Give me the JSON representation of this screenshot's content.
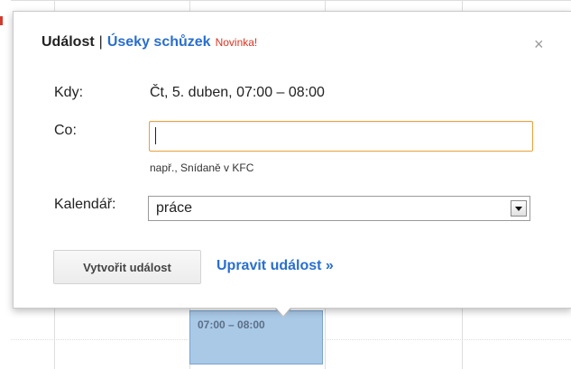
{
  "popup": {
    "tab_event": "Událost",
    "separator": "|",
    "tab_meetings": "Úseky schůzek",
    "new_badge": "Novinka!",
    "close_label": "×",
    "when_label": "Kdy:",
    "when_value": "Čt, 5. duben, 07:00 – 08:00",
    "what_label": "Co:",
    "what_value": "",
    "what_hint": "např., Snídaně v KFC",
    "calendar_label": "Kalendář:",
    "calendar_selected": "práce",
    "create_button": "Vytvořit událost",
    "edit_link": "Upravit událost »"
  },
  "calendar": {
    "event_time": "07:00 – 08:00"
  },
  "colors": {
    "accent_link": "#2a6ecf",
    "new_badge": "#dd3322",
    "input_focus_border": "#e8a33b",
    "event_fill": "#a9c9e7"
  }
}
